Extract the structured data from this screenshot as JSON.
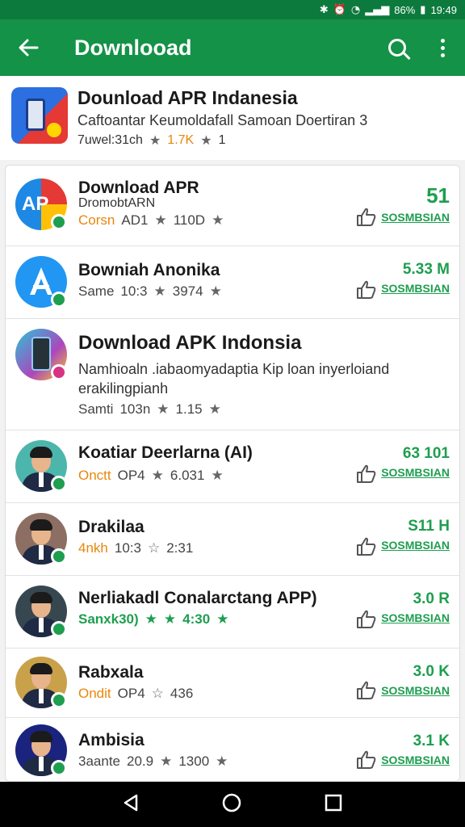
{
  "status": {
    "battery": "86%",
    "time": "19:49"
  },
  "appbar": {
    "title": "Downlooad"
  },
  "featured": {
    "title": "Dounload APR Indanesia",
    "subtitle": "Caftoantar Keumoldafall Samoan Doertiran 3",
    "meta_label": "7uwel:31ch",
    "meta_rating": "1.7K",
    "meta_count": "1"
  },
  "rows": [
    {
      "title": "Download APR",
      "subtitle": "DromobtARN",
      "meta_prefix": "Corsn",
      "meta_mid": "AD1",
      "meta_value": "110D",
      "size": "51",
      "button": "SOSMBSIAN"
    },
    {
      "title": "Bowniah Anonika",
      "meta_prefix": "Same",
      "meta_mid": "10:3",
      "meta_value": "3974",
      "size": "5.33 M",
      "button": "SOSMBSIAN"
    },
    {
      "title": "Download APK Indonsia",
      "description": "Namhioaln .iabaomyadaptia Kip loan inyerloiand erakilingpianh",
      "meta_prefix": "Samti",
      "meta_mid": "103n",
      "meta_value": "1.15",
      "button": ""
    },
    {
      "title": "Koatiar Deerlarna (AI)",
      "meta_prefix": "Onctt",
      "meta_mid": "OP4",
      "meta_value": "6.031",
      "size": "63 101",
      "button": "SOSMBSIAN"
    },
    {
      "title": "Drakilaa",
      "meta_prefix": "4nkh",
      "meta_mid": "10:3",
      "meta_value": "2:31",
      "size": "S11 H",
      "button": "SOSMBSIAN"
    },
    {
      "title": "Nerliakadl Conalarctang APP)",
      "meta_prefix": "Sanxk30)",
      "meta_value": "4:30",
      "size": "3.0 R",
      "button": "SOSMBSIAN"
    },
    {
      "title": "Rabxala",
      "meta_prefix": "Ondit",
      "meta_mid": "OP4",
      "meta_value": "436",
      "size": "3.0 K",
      "button": "SOSMBSIAN"
    },
    {
      "title": "Ambisia",
      "meta_prefix": "3aante",
      "meta_mid": "20.9",
      "meta_value": "1300",
      "size": "3.1 K",
      "button": "SOSMBSIAN"
    }
  ],
  "colors": {
    "primary": "#149247",
    "statusbar": "#0c7a3d",
    "accent": "#1e9e4f",
    "orange": "#e8870c"
  }
}
